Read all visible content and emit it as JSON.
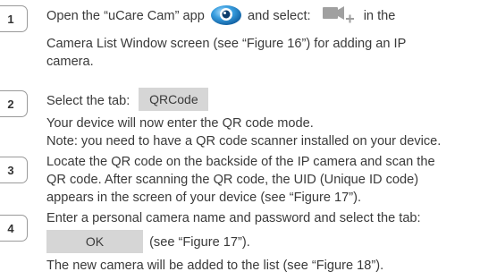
{
  "steps": [
    {
      "number": "1"
    },
    {
      "number": "2"
    },
    {
      "number": "3"
    },
    {
      "number": "4"
    }
  ],
  "step1": {
    "line1_prefix": "Open the “uCare Cam” app",
    "line1_middle": "and select:",
    "line1_suffix": "in the",
    "line2": "Camera List Window screen (see “Figure 16”) for adding an IP",
    "line3": "camera."
  },
  "step2": {
    "line1_prefix": "Select the tab:",
    "tab_label": "QRCode",
    "line2": "Your device will now enter the QR code mode.",
    "line3": "Note: you need to have a QR code scanner installed on your device."
  },
  "step3": {
    "line1": "Locate the QR code on the backside of the IP camera and scan the",
    "line2": "QR code. After scanning the QR code, the UID (Unique ID code)",
    "line3": "appears in the screen of your device (see “Figure 17”)."
  },
  "step4": {
    "line1": "Enter a personal camera name and password and select the tab:",
    "tab_label": "OK",
    "line2_suffix": "(see “Figure 17”).",
    "line3": "The new camera will be added to the list (see “Figure 18”)."
  },
  "icons": {
    "app_icon": "ucare-cam-app-icon",
    "add_camera_icon": "add-camera-icon",
    "app_icon_color": "#1e88c9",
    "add_camera_icon_color": "#9e9e9e"
  }
}
